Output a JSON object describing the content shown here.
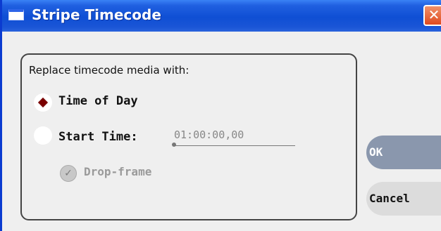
{
  "window": {
    "title": "Stripe Timecode",
    "close_glyph": "✕"
  },
  "group": {
    "label": "Replace timecode media with:"
  },
  "options": {
    "time_of_day": {
      "label": "Time of Day",
      "selected": true
    },
    "start_time": {
      "label": "Start Time:",
      "selected": false,
      "value": "01:00:00,00"
    },
    "drop_frame": {
      "label": "Drop-frame",
      "checked": true,
      "enabled": false,
      "glyph": "✓"
    }
  },
  "buttons": {
    "ok": "OK",
    "cancel": "Cancel"
  },
  "colors": {
    "titlebar": "#0f4fd4",
    "radio_selected": "#7a0000",
    "ok_button": "#8a97ad",
    "cancel_button": "#dcdcdc",
    "close_button": "#e04a1e"
  }
}
